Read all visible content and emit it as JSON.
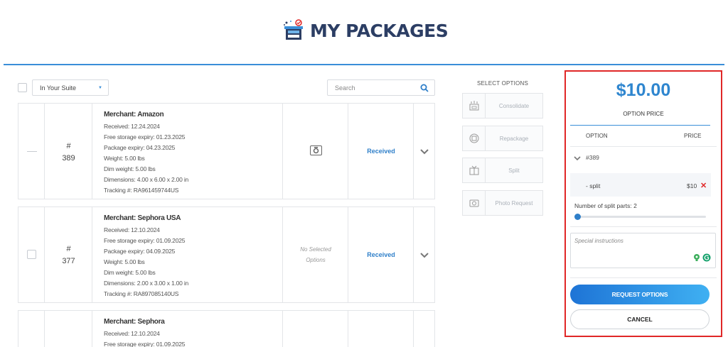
{
  "header": {
    "title": "MY PACKAGES"
  },
  "toolbar": {
    "suite_filter": "In Your Suite",
    "search_placeholder": "Search"
  },
  "packages": [
    {
      "number_prefix": "#",
      "number": "389",
      "merchant": "Merchant: Amazon",
      "received": "Received: 12.24.2024",
      "free_storage": "Free storage expiry: 01.23.2025",
      "package_expiry": "Package expiry: 04.23.2025",
      "weight": "Weight: 5.00 lbs",
      "dim_weight": "Dim weight: 5.00 lbs",
      "dimensions": "Dimensions: 4.00 x 6.00 x 2.00 in",
      "tracking": "Tracking #: RA961459744US",
      "status": "Received"
    },
    {
      "number_prefix": "#",
      "number": "377",
      "merchant": "Merchant: Sephora USA",
      "received": "Received: 12.10.2024",
      "free_storage": "Free storage expiry: 01.09.2025",
      "package_expiry": "Package expiry: 04.09.2025",
      "weight": "Weight: 5.00 lbs",
      "dim_weight": "Dim weight: 5.00 lbs",
      "dimensions": "Dimensions: 2.00 x 3.00 x 1.00 in",
      "tracking": "Tracking #: RA897085140US",
      "options_line1": "No Selected",
      "options_line2": "Options",
      "status": "Received"
    },
    {
      "merchant": "Merchant: Sephora",
      "received": "Received: 12.10.2024",
      "free_storage": "Free storage expiry: 01.09.2025"
    }
  ],
  "select_options": {
    "title": "SELECT OPTIONS",
    "items": [
      {
        "label": "Consolidate",
        "icon": "consolidate-icon"
      },
      {
        "label": "Repackage",
        "icon": "repackage-icon"
      },
      {
        "label": "Split",
        "icon": "split-icon"
      },
      {
        "label": "Photo Request",
        "icon": "camera-icon"
      }
    ]
  },
  "panel": {
    "price": "$10.00",
    "price_label": "OPTION PRICE",
    "col_option": "OPTION",
    "col_price": "PRICE",
    "package_ref": "#389",
    "option_name": "- split",
    "option_price": "$10",
    "remove_glyph": "✕",
    "split_parts_label": "Number of split parts: 2",
    "split_parts_value": 2,
    "instructions_placeholder": "Special instructions",
    "request_button": "REQUEST OPTIONS",
    "cancel_button": "CANCEL"
  },
  "colors": {
    "accent": "#2f86cf",
    "highlight_border": "#e02727",
    "title": "#2c3e64"
  }
}
